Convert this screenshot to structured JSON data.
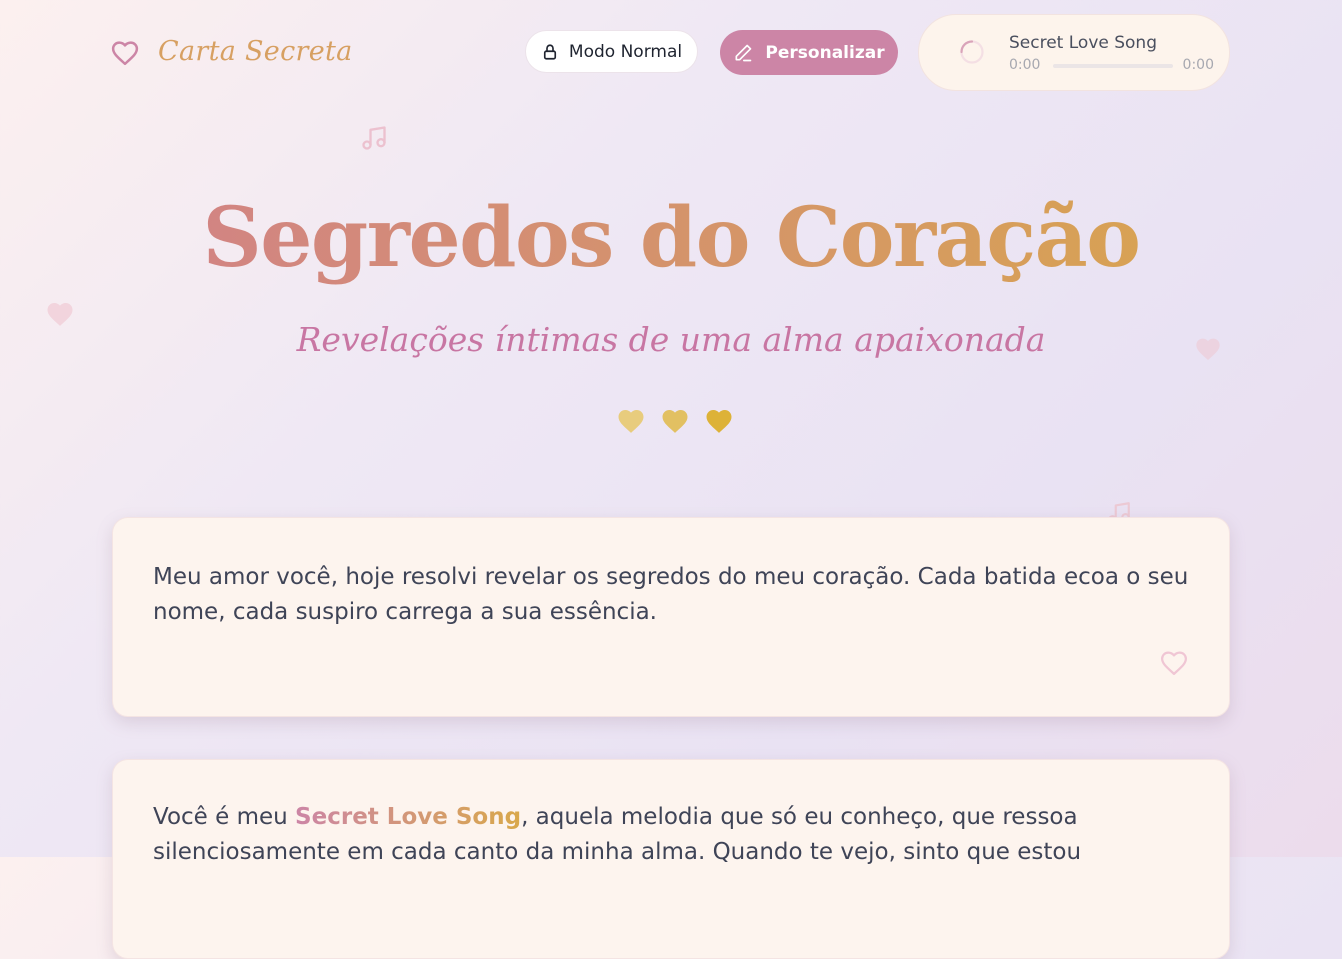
{
  "header": {
    "brand_name": "Carta Secreta",
    "modo_label": "Modo Normal",
    "personalizar_label": "Personalizar"
  },
  "player": {
    "song_title": "Secret Love Song",
    "current_time": "0:00",
    "duration": "0:00",
    "progress": 0
  },
  "hero": {
    "title": "Segredos do Coração",
    "subtitle": "Revelações íntimas de uma alma apaixonada"
  },
  "cards": [
    {
      "text": "Meu amor você, hoje resolvi revelar os segredos do meu coração. Cada batida ecoa o seu nome, cada suspiro carrega a sua essência."
    },
    {
      "text_before": "Você é meu ",
      "highlight": "Secret Love Song",
      "text_after": ", aquela melodia que só eu conheço, que ressoa silenciosamente em cada canto da minha alma. Quando te vejo, sinto que estou"
    }
  ],
  "icons": {
    "brand": "heart-outline-icon",
    "lock": "lock-icon",
    "edit": "pencil-icon",
    "loading": "spinner-icon",
    "card_like": "heart-outline-icon",
    "decor": [
      "music-note-icon",
      "heart-icon"
    ]
  },
  "colors": {
    "accent_pink": "#cc85a6",
    "accent_gold": "#d9a84a",
    "card_bg": "#fdf4ee",
    "text": "#3f4457"
  }
}
